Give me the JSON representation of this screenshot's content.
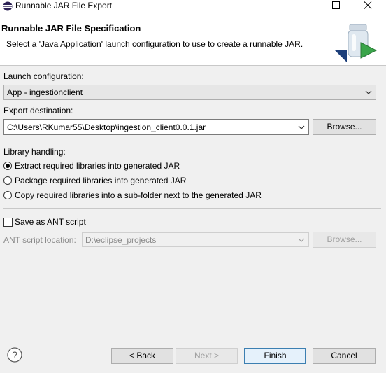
{
  "window": {
    "title": "Runnable JAR File Export",
    "minimize_label": "—",
    "maximize_label": "☐",
    "close_label": "✕"
  },
  "banner": {
    "heading": "Runnable JAR File Specification",
    "description": "Select a 'Java Application' launch configuration to use to create a runnable JAR."
  },
  "launch": {
    "label": "Launch configuration:",
    "value": "App - ingestionclient"
  },
  "export": {
    "label": "Export destination:",
    "value": "C:\\Users\\RKumar55\\Desktop\\ingestion_client0.0.1.jar",
    "browse_label": "Browse..."
  },
  "library": {
    "label": "Library handling:",
    "options": [
      {
        "label": "Extract required libraries into generated JAR",
        "selected": true
      },
      {
        "label": "Package required libraries into generated JAR",
        "selected": false
      },
      {
        "label": "Copy required libraries into a sub-folder next to the generated JAR",
        "selected": false
      }
    ]
  },
  "ant": {
    "checkbox_label": "Save as ANT script",
    "checked": false,
    "location_label": "ANT script location:",
    "location_value": "D:\\eclipse_projects",
    "browse_label": "Browse..."
  },
  "footer": {
    "help_label": "?",
    "back_label": "< Back",
    "next_label": "Next >",
    "finish_label": "Finish",
    "cancel_label": "Cancel"
  }
}
